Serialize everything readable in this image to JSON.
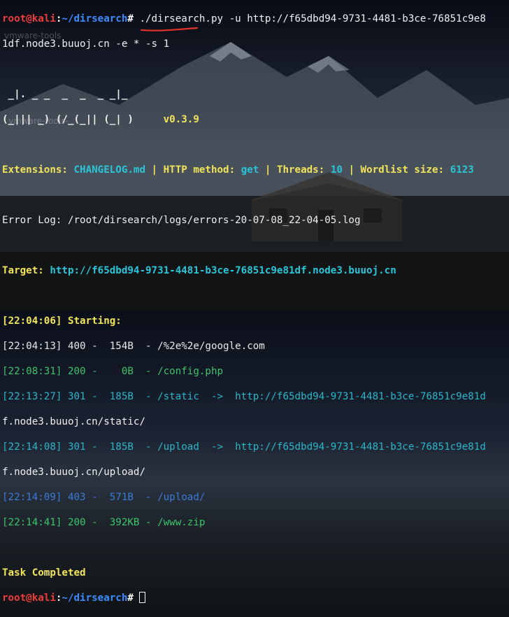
{
  "prompt": {
    "user": "root@kali",
    "sep": ":",
    "path": "~/dirsearch",
    "symbol": "#"
  },
  "command": {
    "line1": " ./dirsearch.py -u http://f65dbd94-9731-4481-b3ce-76851c9e8",
    "line2": "1df.node3.buuoj.cn -e * -s 1"
  },
  "banner": {
    "art1": " _|. _ _  _  _  _ _|_",
    "art2": "(_||| _) (/_(_|| (_| )",
    "version": "v0.3.9"
  },
  "config": {
    "ext_label": "Extensions:",
    "ext_val": "CHANGELOG.md",
    "method_label": "HTTP method:",
    "method_val": "get",
    "threads_label": "Threads:",
    "threads_val": "10",
    "wordlist_label": "Wordlist size:",
    "wordlist_val": "6123",
    "pipe": " | "
  },
  "error_log": "Error Log: /root/dirsearch/logs/errors-20-07-08_22-04-05.log",
  "target": {
    "label": "Target:",
    "url": "http://f65dbd94-9731-4481-b3ce-76851c9e81df.node3.buuoj.cn"
  },
  "starting": "[22:04:06] Starting:",
  "results": [
    {
      "text": "[22:04:13] 400 -  154B  - /%2e%2e/google.com",
      "color": "white"
    },
    {
      "text": "[22:08:31] 200 -    0B  - /config.php",
      "color": "green"
    },
    {
      "text": "[22:13:27] 301 -  185B  - /static  ->  http://f65dbd94-9731-4481-b3ce-76851c9e81d",
      "color": "cyan"
    },
    {
      "text": "f.node3.buuoj.cn/static/",
      "color": "white"
    },
    {
      "text": "[22:14:08] 301 -  185B  - /upload  ->  http://f65dbd94-9731-4481-b3ce-76851c9e81d",
      "color": "cyan"
    },
    {
      "text": "f.node3.buuoj.cn/upload/",
      "color": "white"
    },
    {
      "text": "[22:14:09] 403 -  571B  - /upload/",
      "color": "blue"
    },
    {
      "text": "[22:14:41] 200 -  392KB - /www.zip",
      "color": "green"
    }
  ],
  "task_completed": "Task Completed",
  "watermarks": {
    "w1": "vmware-tools",
    "w2": "vmware-tools-"
  },
  "colors": {
    "user": "#ef3b3b",
    "path": "#3b8cff",
    "yellow": "#f2e45a",
    "cyan": "#2bc5d8",
    "green": "#3cc46a",
    "blue": "#3a7bd5",
    "annotation": "#e0312b"
  }
}
